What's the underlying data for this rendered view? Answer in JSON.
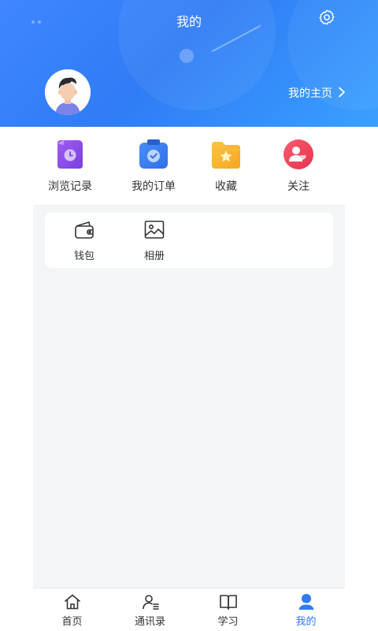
{
  "header": {
    "title": "我的",
    "homepage_link": "我的主页"
  },
  "quick_actions": [
    {
      "label": "浏览记录",
      "icon": "history-clock-icon",
      "color": "#8a4dea"
    },
    {
      "label": "我的订单",
      "icon": "order-clipboard-icon",
      "color": "#3a7ff5"
    },
    {
      "label": "收藏",
      "icon": "star-folder-icon",
      "color": "#f7b52c"
    },
    {
      "label": "关注",
      "icon": "follow-heart-icon",
      "color": "#f0435b"
    }
  ],
  "tools": [
    {
      "label": "钱包",
      "icon": "wallet-icon"
    },
    {
      "label": "相册",
      "icon": "album-image-icon"
    }
  ],
  "tabbar": {
    "active": "我的",
    "accent_color": "#2f7cf5",
    "tabs": [
      {
        "label": "首页",
        "icon": "home-icon"
      },
      {
        "label": "通讯录",
        "icon": "contacts-icon"
      },
      {
        "label": "学习",
        "icon": "book-icon"
      },
      {
        "label": "我的",
        "icon": "profile-icon"
      }
    ]
  }
}
